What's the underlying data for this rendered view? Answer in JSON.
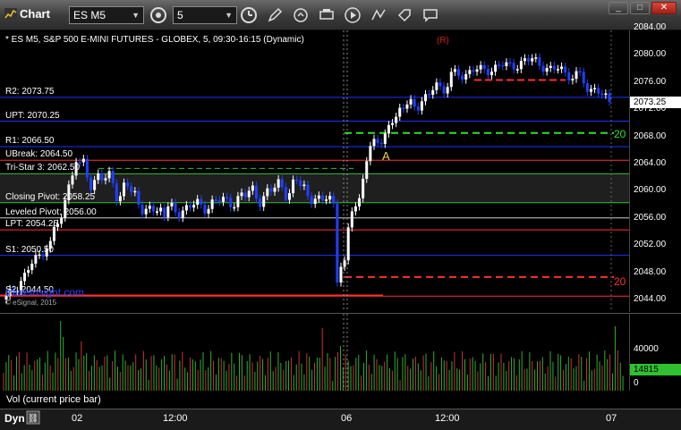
{
  "window": {
    "title": "Chart",
    "symbol": "ES M5",
    "interval": "5",
    "toolbar_icons": [
      "cursor-settings-icon",
      "clock-icon",
      "pencil-icon",
      "redo-icon",
      "print-icon",
      "play-icon",
      "studies-icon",
      "comment-icon"
    ]
  },
  "chart": {
    "title": "* ES M5, S&P 500 E-MINI FUTURES - GLOBEX, 5, 09:30-16:15 (Dynamic)",
    "levels": [
      {
        "label": "R2: 2073.75",
        "price": 2073.75
      },
      {
        "label": "UPT: 2070.25",
        "price": 2070.25
      },
      {
        "label": "R1: 2066.50",
        "price": 2066.5
      },
      {
        "label": "UBreak: 2064.50",
        "price": 2064.5
      },
      {
        "label": "Tri-Star 3: 2062.50",
        "price": 2062.5
      },
      {
        "label": "Closing Pivot: 2058.25",
        "price": 2058.25
      },
      {
        "label": "Leveled Pivot: 2056.00",
        "price": 2056.0
      },
      {
        "label": "LPT: 2054.25",
        "price": 2054.25
      },
      {
        "label": "S1: 2050.50",
        "price": 2050.5
      },
      {
        "label": "S2: 2044.50",
        "price": 2044.5
      }
    ],
    "r_marker": "(R)",
    "a_marker": "A",
    "upper_20": "20",
    "lower_20": "20",
    "watermark": "tradeinsight.com",
    "copyright": "© eSignal, 2015",
    "last_price": "2073.25",
    "colors": {
      "up_candle": "#ffffff",
      "down_candle": "#2040ff",
      "resistance": "#ff3030",
      "support": "#2030ff",
      "pivot_green": "#30c030"
    }
  },
  "price_axis": {
    "ticks": [
      "2084.00",
      "2080.00",
      "2076.00",
      "2072.00",
      "2068.00",
      "2064.00",
      "2060.00",
      "2056.00",
      "2052.00",
      "2048.00",
      "2044.00"
    ]
  },
  "volume": {
    "label": "Vol (current price bar)",
    "ticks": [
      "40000",
      "0"
    ],
    "last_value": "14815"
  },
  "time_axis": {
    "dyn": "Dyn",
    "ticks": [
      "02",
      "12:00",
      "06",
      "12:00",
      "07"
    ]
  }
}
